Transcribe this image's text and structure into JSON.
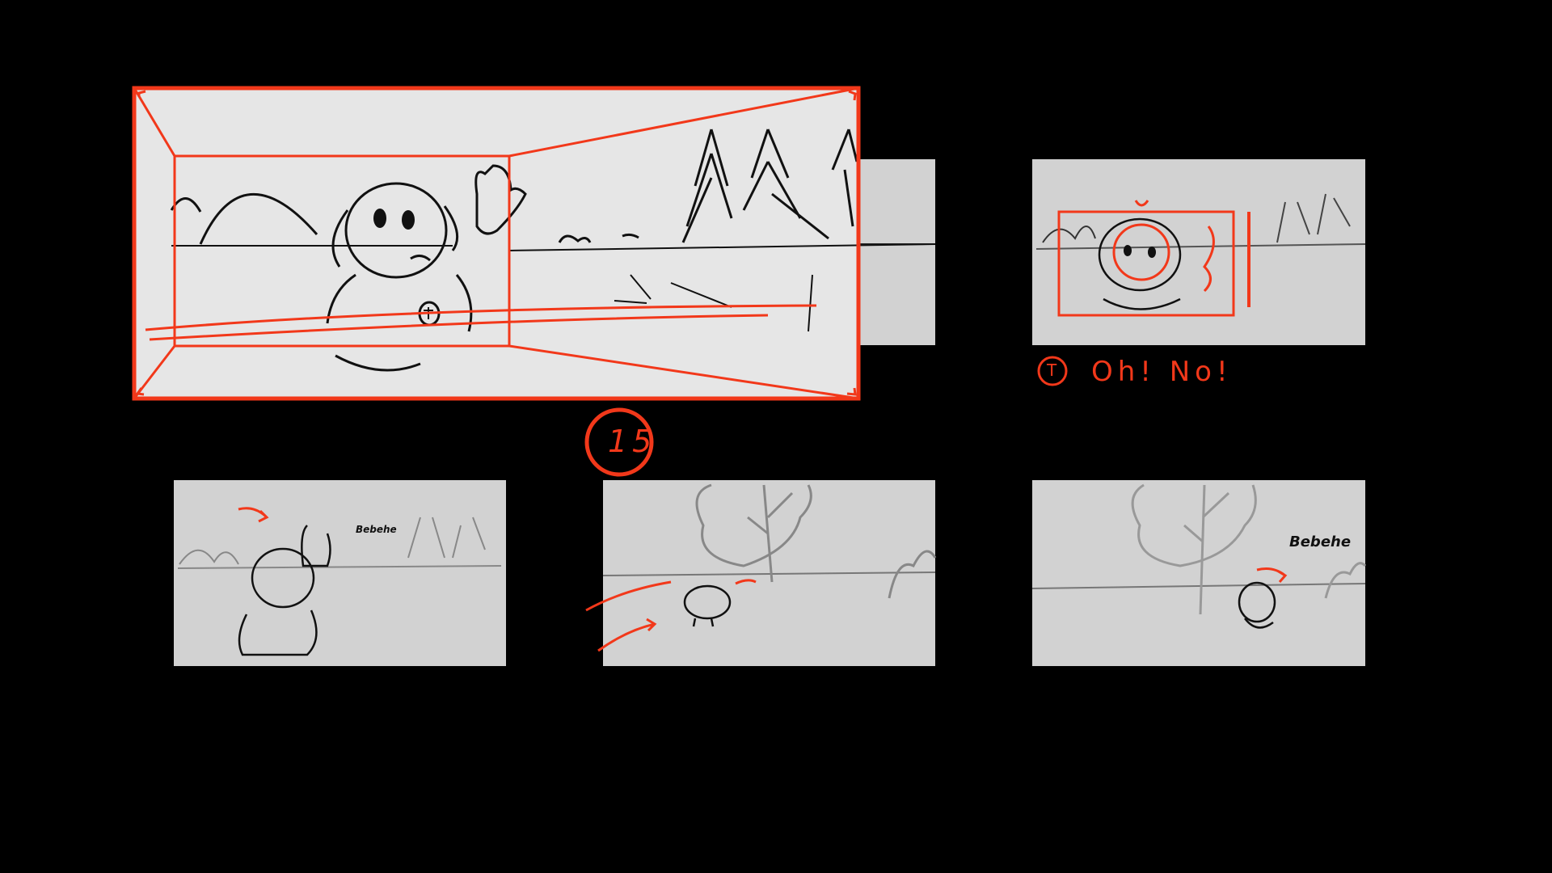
{
  "board": {
    "shot_number": "15",
    "note": {
      "character_mark": "T",
      "line": "Oh! No!"
    },
    "panels": [
      {
        "name": "panel-1-wide-shot",
        "caption": ""
      },
      {
        "name": "panel-2-closeup",
        "caption": ""
      },
      {
        "name": "panel-3-hero-looks-back",
        "caption": "Bebehe"
      },
      {
        "name": "panel-4-puppy-runs",
        "caption": ""
      },
      {
        "name": "panel-5-puppy-laughs",
        "caption": "Bebehe"
      }
    ],
    "colors": {
      "background": "#000000",
      "panel_fill": "#d2d2d2",
      "expanded_panel_fill": "#e6e6e6",
      "redline": "#f2381a",
      "ink": "#111111",
      "pencil": "#888888"
    }
  }
}
